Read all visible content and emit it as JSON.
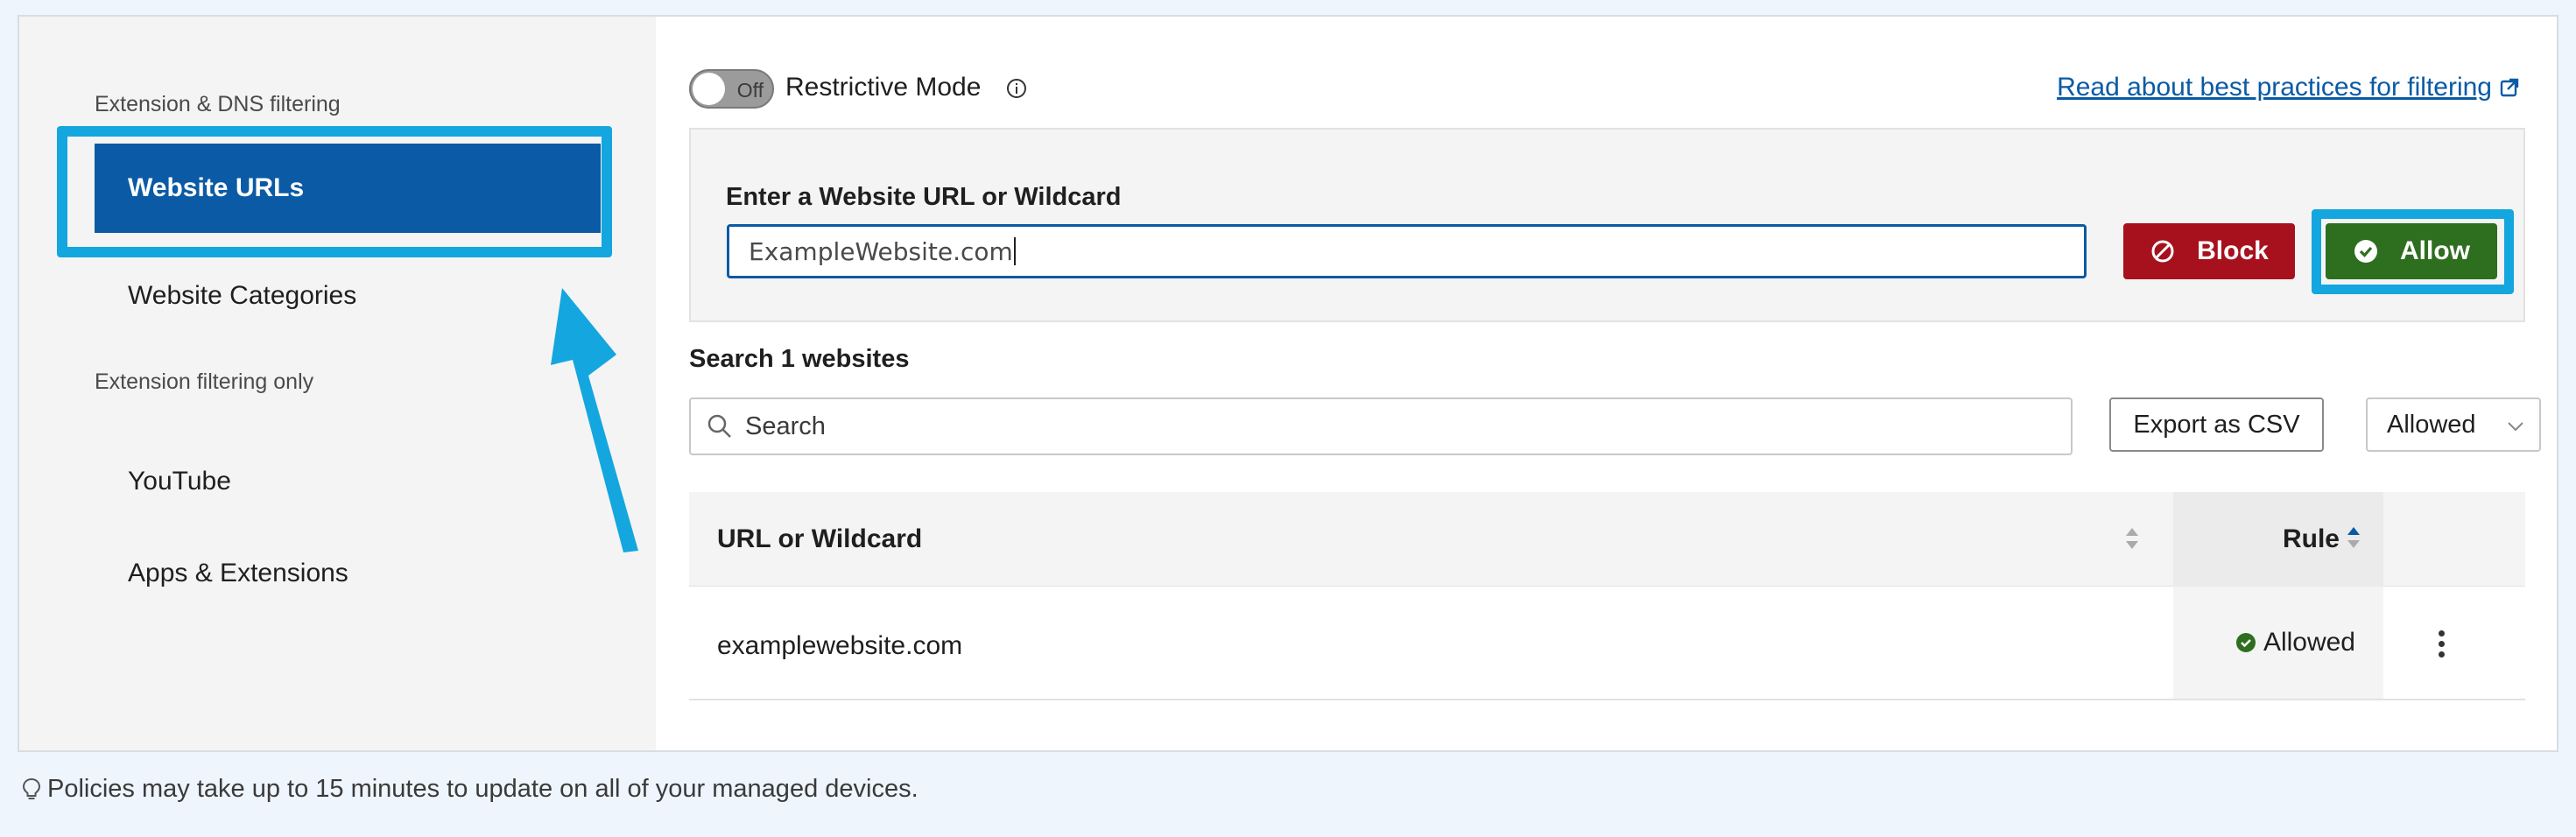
{
  "sidebar": {
    "section_1": "Extension & DNS filtering",
    "section_2": "Extension filtering only",
    "items": [
      {
        "label": "Website URLs",
        "active": true
      },
      {
        "label": "Website Categories",
        "active": false
      },
      {
        "label": "YouTube",
        "active": false
      },
      {
        "label": "Apps & Extensions",
        "active": false
      }
    ]
  },
  "toggle": {
    "state_text": "Off",
    "label": "Restrictive Mode"
  },
  "link": {
    "best_practices": "Read about best practices for filtering"
  },
  "entry": {
    "label": "Enter a Website URL or Wildcard",
    "value": "ExampleWebsite.com",
    "block_label": "Block",
    "allow_label": "Allow"
  },
  "search": {
    "title": "Search 1 websites",
    "placeholder": "Search",
    "export_label": "Export as CSV",
    "filter_value": "Allowed"
  },
  "table": {
    "col_url": "URL or Wildcard",
    "col_rule": "Rule",
    "rows": [
      {
        "url": "examplewebsite.com",
        "rule": "Allowed"
      }
    ]
  },
  "footer": {
    "note": "Policies may take up to 15 minutes to update on all of your managed devices."
  },
  "colors": {
    "primary": "#0a5aa5",
    "block": "#a7111d",
    "allow": "#2d6e1f",
    "highlight": "#14a6df"
  },
  "icons": [
    "info-icon",
    "external-link-icon",
    "block-icon",
    "check-circle-icon",
    "search-icon",
    "chevron-down-icon",
    "sort-icon",
    "kebab-menu-icon",
    "lightbulb-icon",
    "annotation-arrow"
  ]
}
